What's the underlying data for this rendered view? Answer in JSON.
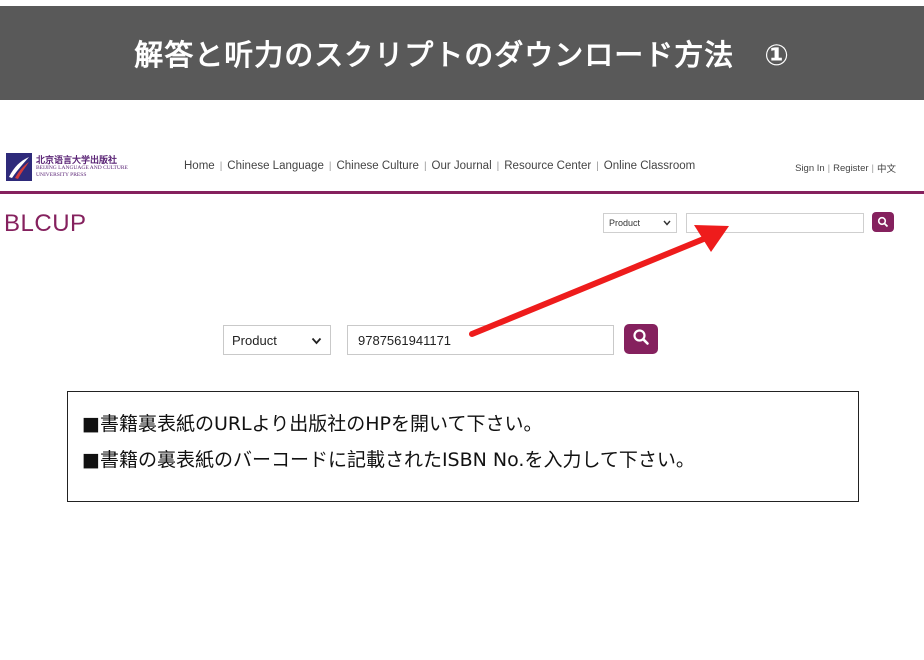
{
  "banner": {
    "title": "解答と听力のスクリプトのダウンロード方法　①"
  },
  "site": {
    "logo": {
      "cn": "北京语言大学出版社",
      "en_line1": "BEIJING LANGUAGE AND CULTURE",
      "en_line2": "UNIVERSITY PRESS"
    },
    "nav": [
      "Home",
      "Chinese Language",
      "Chinese Culture",
      "Our Journal",
      "Resource Center",
      "Online Classroom"
    ],
    "user_nav": {
      "sign_in": "Sign In",
      "register": "Register",
      "lang": "中文"
    },
    "brand": "BLCUP",
    "header_search": {
      "select_value": "Product",
      "input_value": ""
    },
    "separator": "|"
  },
  "search": {
    "select_value": "Product",
    "input_value": "9787561941171"
  },
  "notes": [
    "■書籍裏表紙のURLより出版社のHPを開いて下さい。",
    "■書籍の裏表紙のバーコードに記載されたISBN No.を入力して下さい。"
  ],
  "colors": {
    "brand": "#85215e",
    "banner": "#595959",
    "arrow": "#ee1c1c"
  },
  "icons": {
    "search": "search-icon",
    "dropdown": "chevron-down-icon",
    "arrow": "red-arrow"
  }
}
